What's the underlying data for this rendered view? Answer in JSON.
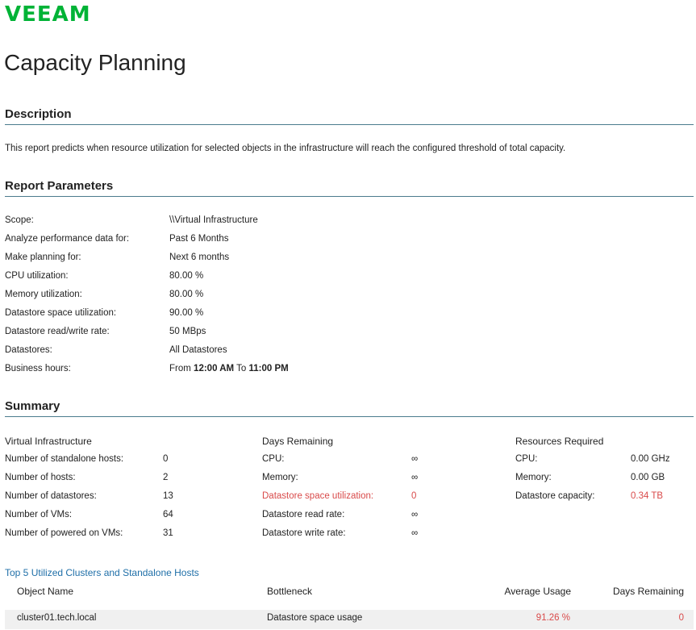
{
  "brand": {
    "logo_text": "VEEAM",
    "accent": "#00b336"
  },
  "page_title": "Capacity Planning",
  "description": {
    "heading": "Description",
    "text": "This report predicts when resource utilization for selected objects in the infrastructure will reach the configured threshold of total capacity."
  },
  "parameters": {
    "heading": "Report Parameters",
    "rows": [
      {
        "label": "Scope:",
        "value": "\\\\Virtual Infrastructure"
      },
      {
        "label": "Analyze performance data for:",
        "value": "Past 6 Months"
      },
      {
        "label": "Make planning for:",
        "value": "Next 6 months"
      },
      {
        "label": "CPU utilization:",
        "value": "80.00 %"
      },
      {
        "label": "Memory utilization:",
        "value": "80.00 %"
      },
      {
        "label": "Datastore space utilization:",
        "value": "90.00 %"
      },
      {
        "label": "Datastore read/write rate:",
        "value": "50 MBps"
      },
      {
        "label": "Datastores:",
        "value": "All Datastores"
      }
    ],
    "business_hours": {
      "label": "Business hours:",
      "from_word": "From",
      "from_time": "12:00 AM",
      "to_word": "To",
      "to_time": "11:00 PM"
    }
  },
  "summary": {
    "heading": "Summary",
    "virtual_infrastructure": {
      "heading": "Virtual Infrastructure",
      "rows": [
        {
          "label": "Number of standalone hosts:",
          "value": "0"
        },
        {
          "label": "Number of hosts:",
          "value": "2"
        },
        {
          "label": "Number of datastores:",
          "value": "13"
        },
        {
          "label": "Number of VMs:",
          "value": "64"
        },
        {
          "label": "Number of powered on VMs:",
          "value": "31"
        }
      ]
    },
    "days_remaining": {
      "heading": "Days Remaining",
      "rows": [
        {
          "label": "CPU:",
          "value": "∞"
        },
        {
          "label": "Memory:",
          "value": "∞"
        },
        {
          "label": "Datastore space utilization:",
          "value": "0"
        },
        {
          "label": "Datastore read rate:",
          "value": "∞"
        },
        {
          "label": "Datastore write rate:",
          "value": "∞"
        }
      ]
    },
    "resources_required": {
      "heading": "Resources Required",
      "rows": [
        {
          "label": "CPU:",
          "value": "0.00 GHz"
        },
        {
          "label": "Memory:",
          "value": "0.00 GB"
        },
        {
          "label": "Datastore capacity:",
          "value": "0.34 TB"
        }
      ]
    }
  },
  "top5": {
    "title": "Top 5 Utilized Clusters and Standalone Hosts",
    "columns": [
      "Object Name",
      "Bottleneck",
      "Average Usage",
      "Days Remaining"
    ],
    "rows": [
      {
        "object_name": "cluster01.tech.local",
        "bottleneck": "Datastore space usage",
        "average_usage": "91.26 %",
        "days_remaining": "0"
      }
    ]
  },
  "colors": {
    "rule": "#4b7b8d",
    "alert": "#d94a4a",
    "link": "#1f6fa8"
  }
}
